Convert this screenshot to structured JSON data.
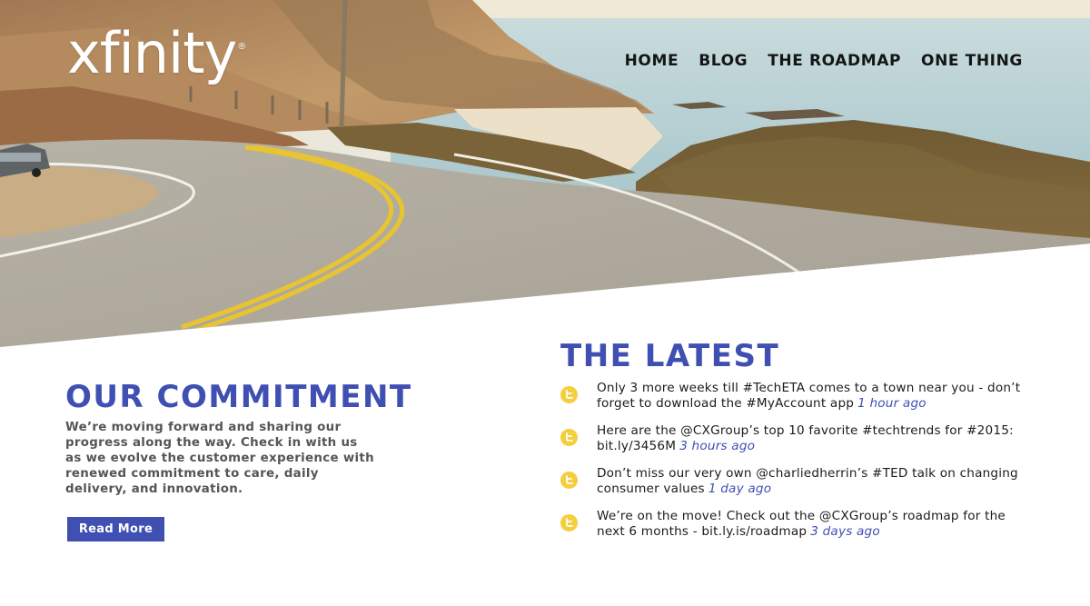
{
  "brand": {
    "logo_text": "xfinity",
    "logo_mark": "®"
  },
  "nav": {
    "items": [
      {
        "label": "HOME"
      },
      {
        "label": "BLOG"
      },
      {
        "label": "THE ROADMAP"
      },
      {
        "label": "ONE THING"
      }
    ]
  },
  "commitment": {
    "title": "OUR COMMITMENT",
    "body": "We’re moving forward and sharing our progress along the way. Check in with us as we evolve the customer experience with renewed commitment to care, daily delivery, and innovation.",
    "button_label": "Read More"
  },
  "latest": {
    "title": "THE LATEST",
    "tweets": [
      {
        "icon": "twitter-icon",
        "text": "Only 3 more weeks till #TechETA comes to a town near you - don’t forget to download the #MyAccount app",
        "time": "1 hour ago"
      },
      {
        "icon": "twitter-icon",
        "text": "Here are the @CXGroup’s top 10 favorite #techtrends for #2015: bit.ly/3456M",
        "time": "3 hours ago"
      },
      {
        "icon": "twitter-icon",
        "text": "Don’t miss our very own @charliedherrin’s #TED talk on changing consumer values",
        "time": "1 day ago"
      },
      {
        "icon": "twitter-icon",
        "text": "We’re on the move! Check out the @CXGroup’s roadmap for the next 6 months - bit.ly.is/roadmap",
        "time": "3 days ago"
      }
    ]
  },
  "colors": {
    "accent": "#3f4fb2",
    "twitter_icon": "#f5ce3e",
    "nav_text": "#151515",
    "body_text": "#555555"
  }
}
